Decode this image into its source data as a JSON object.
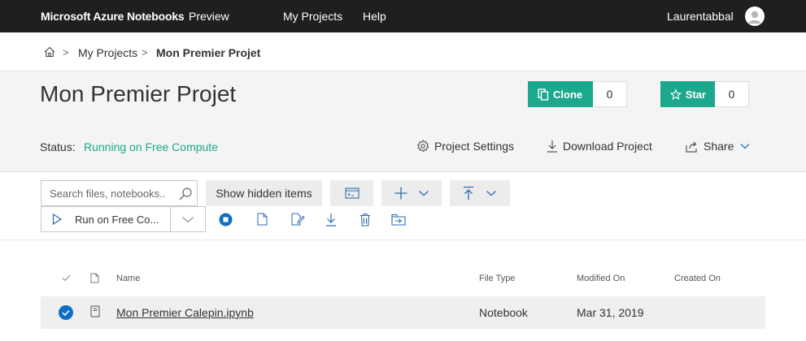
{
  "topnav": {
    "brand": "Microsoft Azure Notebooks",
    "preview": "Preview",
    "links": [
      "My Projects",
      "Help"
    ],
    "user": "Laurentabbal"
  },
  "breadcrumb": {
    "items": [
      "My Projects",
      "Mon Premier Projet"
    ],
    "separator": ">"
  },
  "project": {
    "title": "Mon Premier Projet",
    "clone_label": "Clone",
    "clone_count": "0",
    "star_label": "Star",
    "star_count": "0",
    "status_label": "Status:",
    "status_value": "Running on Free Compute",
    "settings_label": "Project Settings",
    "download_label": "Download Project",
    "share_label": "Share"
  },
  "toolbar": {
    "search_placeholder": "Search files, notebooks..",
    "show_hidden_label": "Show hidden items",
    "run_label": "Run on Free Co..."
  },
  "list": {
    "columns": [
      "Name",
      "File Type",
      "Modified On",
      "Created On"
    ],
    "rows": [
      {
        "name": "Mon Premier Calepin.ipynb",
        "type": "Notebook",
        "modified": "Mar 31, 2019",
        "created": ""
      }
    ]
  },
  "colors": {
    "accent_green": "#1ba88c",
    "accent_blue": "#0f6fc6",
    "nav_bg": "#1f1f1f"
  }
}
